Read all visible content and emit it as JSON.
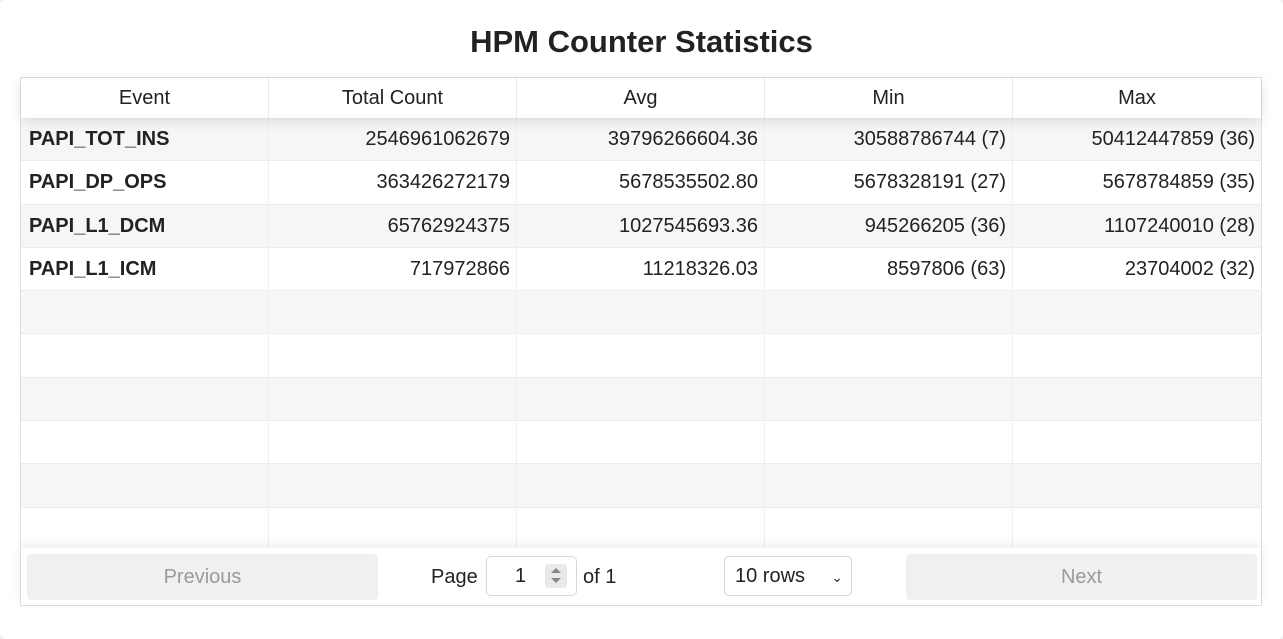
{
  "title": "HPM Counter Statistics",
  "table": {
    "columns": [
      "Event",
      "Total Count",
      "Avg",
      "Min",
      "Max"
    ],
    "rows": [
      {
        "event": "PAPI_TOT_INS",
        "total": "2546961062679",
        "avg": "39796266604.36",
        "min": "30588786744 (7)",
        "max": "50412447859 (36)"
      },
      {
        "event": "PAPI_DP_OPS",
        "total": "363426272179",
        "avg": "5678535502.80",
        "min": "5678328191 (27)",
        "max": "5678784859 (35)"
      },
      {
        "event": "PAPI_L1_DCM",
        "total": "65762924375",
        "avg": "1027545693.36",
        "min": "945266205 (36)",
        "max": "1107240010 (28)"
      },
      {
        "event": "PAPI_L1_ICM",
        "total": "717972866",
        "avg": "11218326.03",
        "min": "8597806 (63)",
        "max": "23704002 (32)"
      }
    ],
    "empty_rows": 6
  },
  "pagination": {
    "previous_label": "Previous",
    "page_label": "Page",
    "page_value": "1",
    "of_label": "of 1",
    "rows_option": "10 rows",
    "next_label": "Next"
  }
}
